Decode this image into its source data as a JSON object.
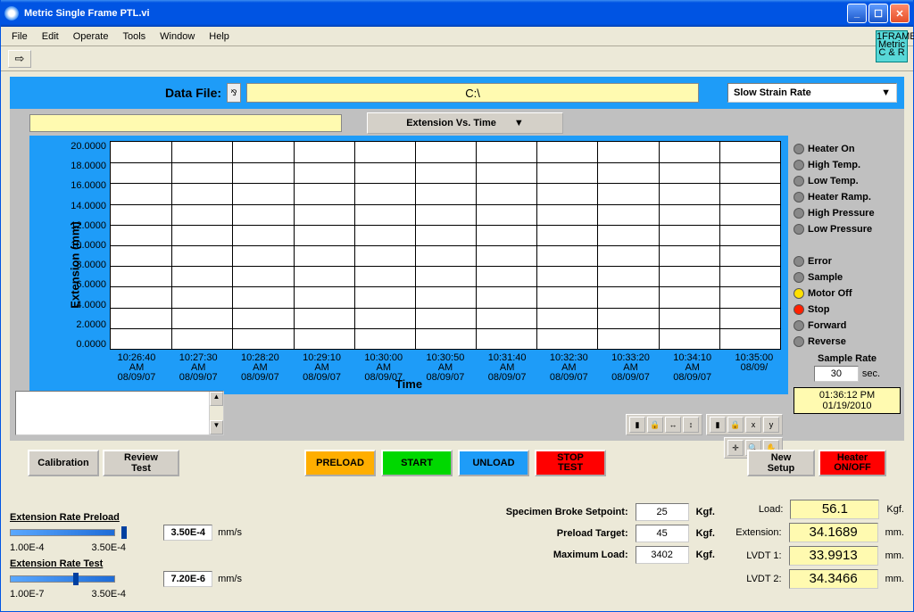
{
  "window": {
    "title": "Metric Single Frame PTL.vi"
  },
  "menu": {
    "file": "File",
    "edit": "Edit",
    "operate": "Operate",
    "tools": "Tools",
    "window": "Window",
    "help": "Help"
  },
  "badge": {
    "l1": "1FRAME",
    "l2": "Metric",
    "l3": "C & R"
  },
  "datafile": {
    "label": "Data File:",
    "path": "C:\\"
  },
  "rate_mode": "Slow Strain Rate",
  "chart": {
    "type_label": "Extension Vs. Time",
    "ylabel": "Extension (mm)",
    "xlabel": "Time"
  },
  "chart_data": {
    "type": "line",
    "title": "Extension Vs. Time",
    "xlabel": "Time",
    "ylabel": "Extension (mm)",
    "ylim": [
      0,
      20
    ],
    "y_ticks": [
      "20.0000",
      "18.0000",
      "16.0000",
      "14.0000",
      "12.0000",
      "10.0000",
      "8.0000",
      "6.0000",
      "4.0000",
      "2.0000",
      "0.0000"
    ],
    "x_ticks": [
      {
        "t": "10:26:40 AM",
        "d": "08/09/07"
      },
      {
        "t": "10:27:30 AM",
        "d": "08/09/07"
      },
      {
        "t": "10:28:20 AM",
        "d": "08/09/07"
      },
      {
        "t": "10:29:10 AM",
        "d": "08/09/07"
      },
      {
        "t": "10:30:00 AM",
        "d": "08/09/07"
      },
      {
        "t": "10:30:50 AM",
        "d": "08/09/07"
      },
      {
        "t": "10:31:40 AM",
        "d": "08/09/07"
      },
      {
        "t": "10:32:30 AM",
        "d": "08/09/07"
      },
      {
        "t": "10:33:20 AM",
        "d": "08/09/07"
      },
      {
        "t": "10:34:10 AM",
        "d": "08/09/07"
      },
      {
        "t": "10:35:00",
        "d": "08/09/"
      }
    ],
    "series": [
      {
        "name": "Extension",
        "values": []
      }
    ]
  },
  "indicators": {
    "heater_on": "Heater On",
    "high_temp": "High Temp.",
    "low_temp": "Low Temp.",
    "heater_ramp": "Heater Ramp.",
    "high_pressure": "High Pressure",
    "low_pressure": "Low Pressure",
    "error": "Error",
    "sample": "Sample",
    "motor_off": "Motor Off",
    "stop": "Stop",
    "forward": "Forward",
    "reverse": "Reverse"
  },
  "sample_rate": {
    "label": "Sample Rate",
    "value": "30",
    "unit": "sec."
  },
  "clock": {
    "time": "01:36:12 PM",
    "date": "01/19/2010"
  },
  "buttons": {
    "calibration": "Calibration",
    "review": "Review Test",
    "preload": "PRELOAD",
    "start": "START",
    "unload": "UNLOAD",
    "stop": "STOP TEST",
    "new_setup": "New Setup",
    "heater": "Heater ON/OFF"
  },
  "sliders": {
    "preload": {
      "title": "Extension Rate Preload",
      "value": "3.50E-4",
      "unit": "mm/s",
      "min": "1.00E-4",
      "max": "3.50E-4"
    },
    "test": {
      "title": "Extension Rate Test",
      "value": "7.20E-6",
      "unit": "mm/s",
      "min": "1.00E-7",
      "max": "3.50E-4"
    }
  },
  "setpoints": {
    "broke": {
      "label": "Specimen Broke Setpoint:",
      "value": "25",
      "unit": "Kgf."
    },
    "preload": {
      "label": "Preload Target:",
      "value": "45",
      "unit": "Kgf."
    },
    "maxload": {
      "label": "Maximum Load:",
      "value": "3402",
      "unit": "Kgf."
    }
  },
  "readouts": {
    "load": {
      "label": "Load:",
      "value": "56.1",
      "unit": "Kgf."
    },
    "extension": {
      "label": "Extension:",
      "value": "34.1689",
      "unit": "mm."
    },
    "lvdt1": {
      "label": "LVDT 1:",
      "value": "33.9913",
      "unit": "mm."
    },
    "lvdt2": {
      "label": "LVDT 2:",
      "value": "34.3466",
      "unit": "mm."
    }
  }
}
